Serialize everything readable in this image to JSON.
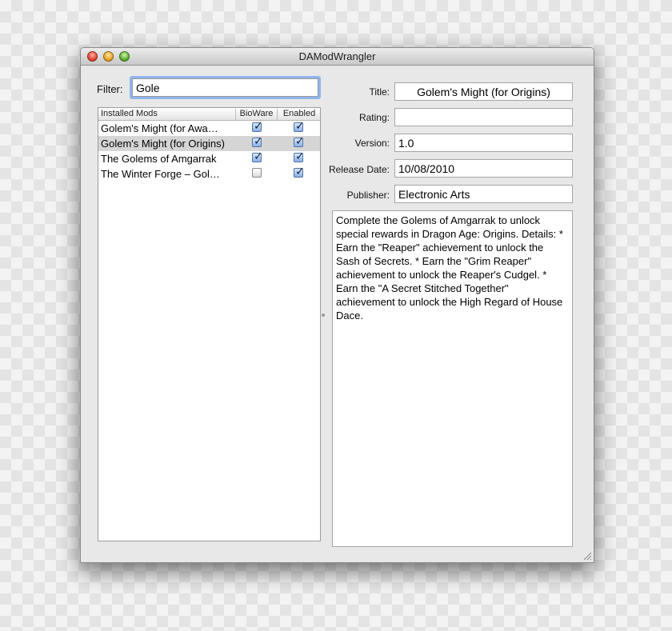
{
  "window": {
    "title": "DAModWrangler"
  },
  "filter": {
    "label": "Filter:",
    "value": "Gole"
  },
  "mods_table": {
    "headers": {
      "name": "Installed Mods",
      "bioware": "BioWare",
      "enabled": "Enabled"
    },
    "rows": [
      {
        "name": "Golem's Might (for Awa…",
        "bioware": true,
        "enabled": true,
        "selected": false
      },
      {
        "name": "Golem's Might (for Origins)",
        "bioware": true,
        "enabled": true,
        "selected": true
      },
      {
        "name": "The Golems of Amgarrak",
        "bioware": true,
        "enabled": true,
        "selected": false
      },
      {
        "name": "The Winter Forge – Gol…",
        "bioware": false,
        "enabled": true,
        "selected": false
      }
    ]
  },
  "details": {
    "title_label": "Title:",
    "title_value": "Golem's Might (for Origins)",
    "rating_label": "Rating:",
    "rating_value": "",
    "version_label": "Version:",
    "version_value": "1.0",
    "release_label": "Release Date:",
    "release_value": "10/08/2010",
    "publisher_label": "Publisher:",
    "publisher_value": "Electronic Arts",
    "description": "Complete the Golems of Amgarrak to unlock special rewards in Dragon Age: Origins. Details: * Earn the \"Reaper\" achievement to unlock the Sash of Secrets. * Earn the \"Grim Reaper\" achievement to unlock the Reaper's Cudgel. * Earn the \"A Secret Stitched Together\" achievement to unlock the High Regard of House Dace."
  }
}
